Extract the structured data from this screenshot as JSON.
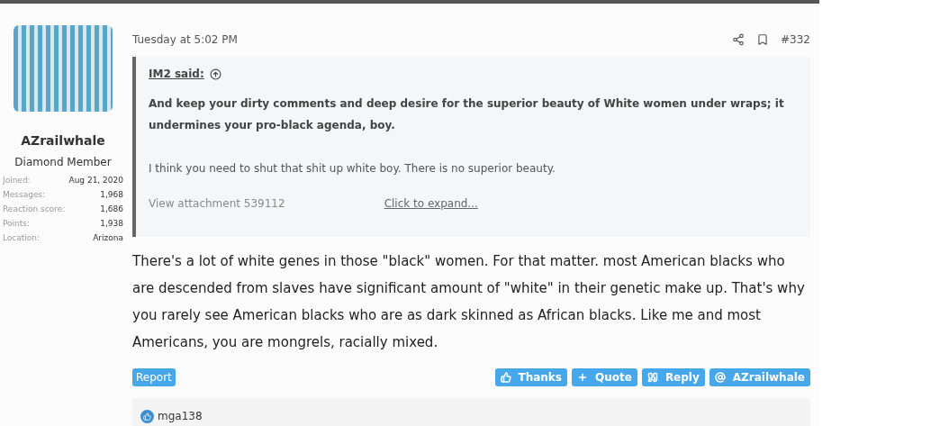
{
  "author": {
    "name": "AZrailwhale",
    "title": "Diamond Member",
    "stats": [
      {
        "label": "Joined:",
        "value": "Aug 21, 2020"
      },
      {
        "label": "Messages:",
        "value": "1,968"
      },
      {
        "label": "Reaction score:",
        "value": "1,686"
      },
      {
        "label": "Points:",
        "value": "1,938"
      },
      {
        "label": "Location:",
        "value": "Arizona"
      }
    ]
  },
  "post": {
    "time": "Tuesday at 5:02 PM",
    "number": "#332",
    "quote": {
      "author": "IM2 said:",
      "bold_text": "And keep your dirty comments and deep desire for the superior beauty of White women under wraps; it undermines your pro-black agenda, boy.",
      "text": "I think you need to shut that shit up white boy. There is no superior beauty.",
      "attachment": "View attachment 539112",
      "expand": "Click to expand..."
    },
    "body": "There's a lot of white genes in those \"black\" women. For that matter. most American blacks who are descended from slaves have significant amount of \"white\" in their genetic make up. That's why you rarely see American blacks who are as dark skinned as African blacks. Like me and most Americans, you are mongrels, racially mixed.",
    "report": "Report",
    "actions": [
      {
        "kind": "thanks",
        "label": "Thanks"
      },
      {
        "kind": "quote",
        "label": "Quote"
      },
      {
        "kind": "reply",
        "label": "Reply"
      },
      {
        "kind": "mention",
        "label": "AZrailwhale"
      }
    ],
    "reactions": "mga138"
  }
}
